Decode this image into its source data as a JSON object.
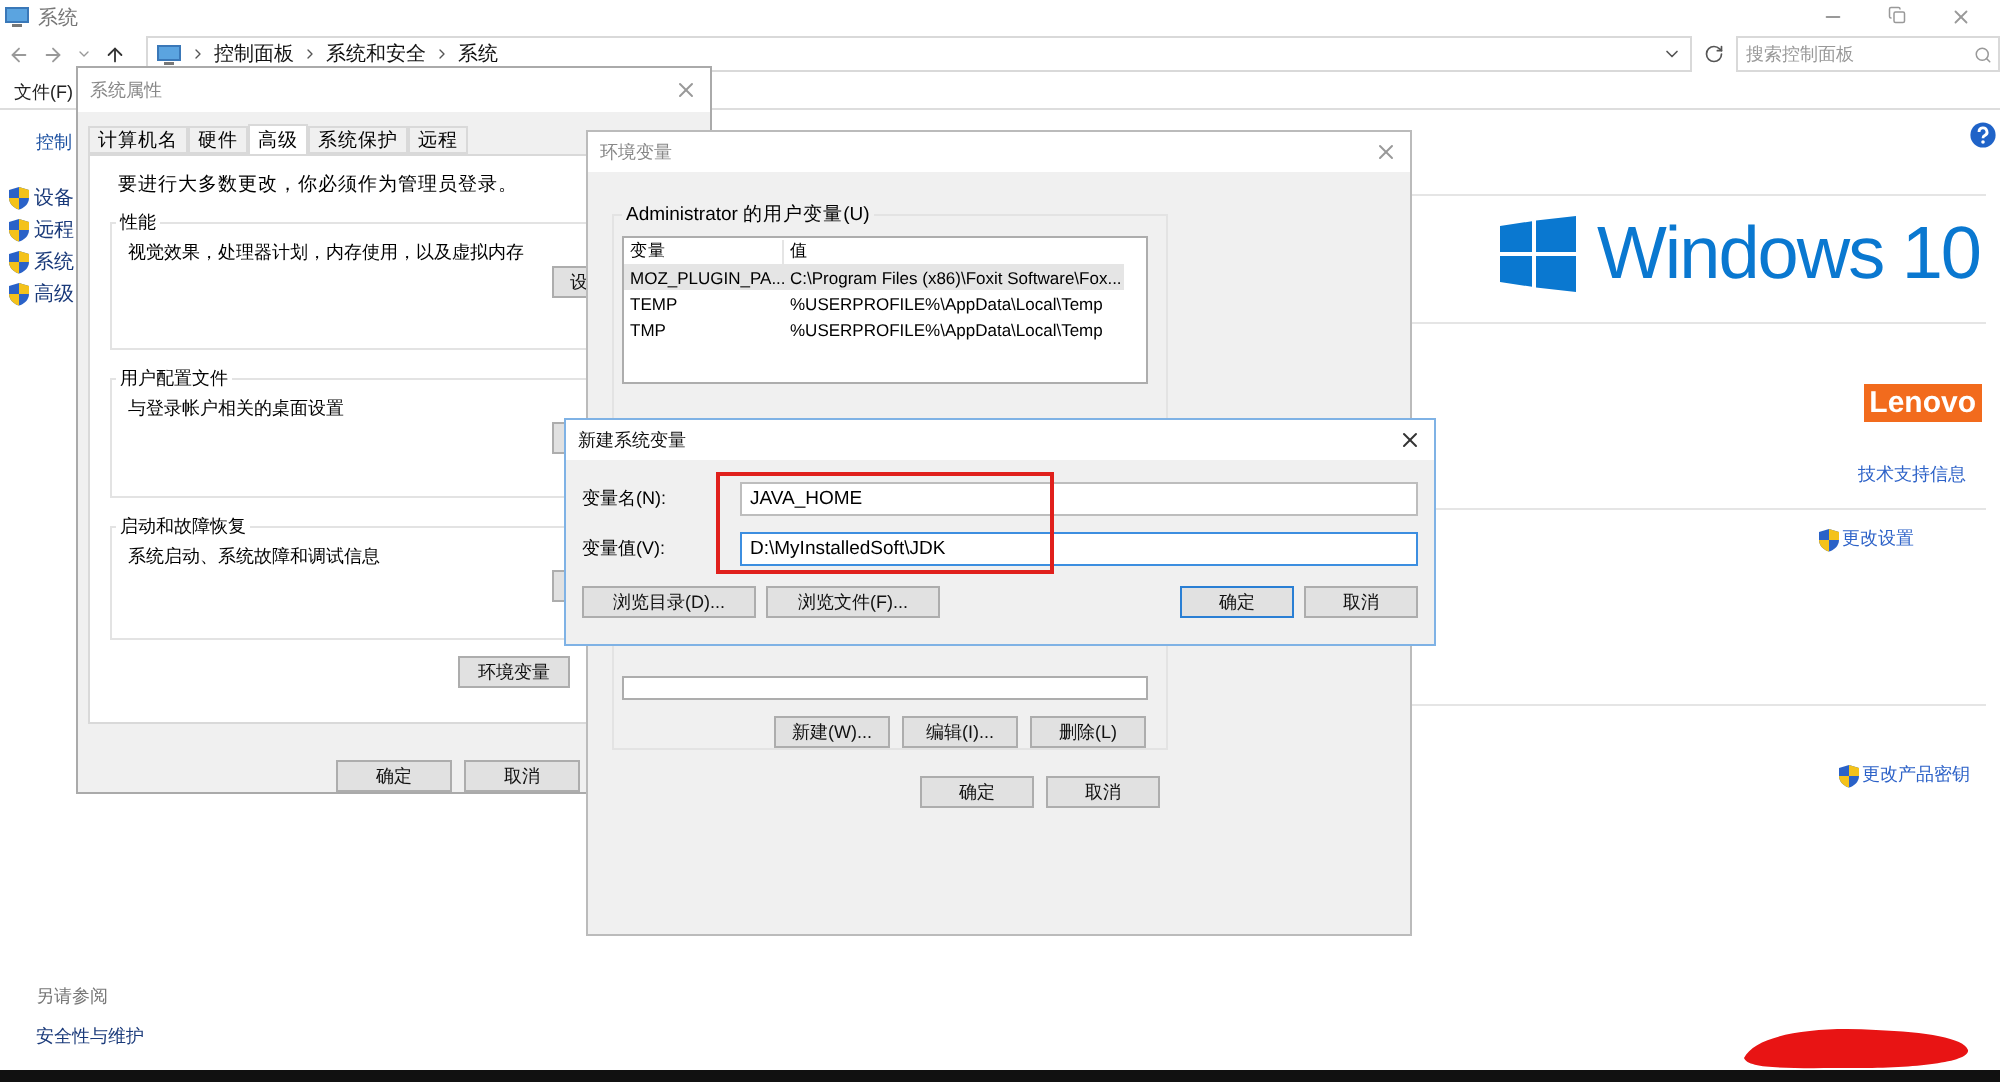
{
  "main_window": {
    "title": "系统",
    "breadcrumb": [
      "控制面板",
      "系统和安全",
      "系统"
    ],
    "search": {
      "placeholder": "搜索控制面板"
    },
    "menu": [
      "文件(F)"
    ],
    "sidebar": {
      "heading": "控制",
      "items": [
        "设备",
        "远程",
        "系统",
        "高级"
      ],
      "see_also_heading": "另请参阅",
      "see_also_links": [
        "安全性与维护"
      ]
    },
    "windows_logo_text": "Windows 10",
    "brand_logo_text": "Lenovo",
    "links": [
      {
        "label": "技术支持信息",
        "shield": false
      },
      {
        "label": "更改设置",
        "shield": true
      },
      {
        "label": "更改产品密钥",
        "shield": true
      }
    ]
  },
  "system_properties": {
    "title": "系统属性",
    "tabs": [
      {
        "label": "计算机名",
        "selected": false
      },
      {
        "label": "硬件",
        "selected": false
      },
      {
        "label": "高级",
        "selected": true
      },
      {
        "label": "系统保护",
        "selected": false
      },
      {
        "label": "远程",
        "selected": false
      }
    ],
    "notice": "要进行大多数更改，你必须作为管理员登录。",
    "groups": [
      {
        "heading": "性能",
        "description": "视觉效果，处理器计划，内存使用，以及虚拟内存",
        "button": "设"
      },
      {
        "heading": "用户配置文件",
        "description": "与登录帐户相关的桌面设置"
      },
      {
        "heading": "启动和故障恢复",
        "description": "系统启动、系统故障和调试信息"
      }
    ],
    "env_button": "环境变量",
    "buttons": [
      "确定",
      "取消"
    ]
  },
  "environment_variables": {
    "title": "环境变量",
    "user_group": "Administrator 的用户变量(U)",
    "columns": [
      "变量",
      "值"
    ],
    "rows": [
      {
        "name": "MOZ_PLUGIN_PA...",
        "value": "C:\\Program Files (x86)\\Foxit Software\\Fox...",
        "selected": true
      },
      {
        "name": "TEMP",
        "value": "%USERPROFILE%\\AppData\\Local\\Temp",
        "selected": false
      },
      {
        "name": "TMP",
        "value": "%USERPROFILE%\\AppData\\Local\\Temp",
        "selected": false
      }
    ],
    "system_buttons": [
      "新建(W)...",
      "编辑(I)...",
      "删除(L)"
    ],
    "buttons": [
      "确定",
      "取消"
    ]
  },
  "new_variable_dialog": {
    "title": "新建系统变量",
    "fields": [
      {
        "label": "变量名(N):",
        "value": "JAVA_HOME",
        "focused": false
      },
      {
        "label": "变量值(V):",
        "value": "D:\\MyInstalledSoft\\JDK",
        "focused": true
      }
    ],
    "browse_buttons": [
      "浏览目录(D)...",
      "浏览文件(F)..."
    ],
    "buttons": [
      {
        "label": "确定",
        "default": true
      },
      {
        "label": "取消",
        "default": false
      }
    ]
  }
}
